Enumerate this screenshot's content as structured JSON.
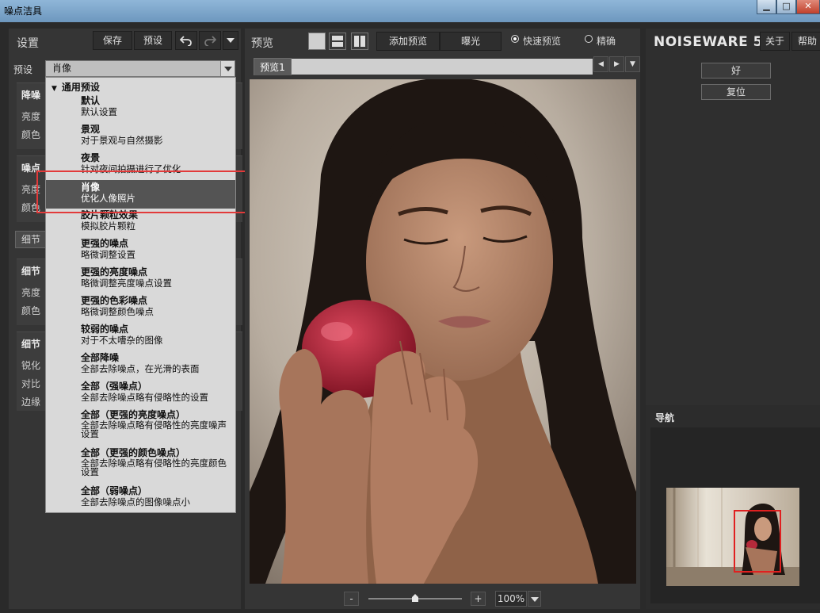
{
  "window": {
    "title": "噪点洁具",
    "min_glyph": "▁",
    "max_glyph": "□",
    "close_glyph": "✕"
  },
  "left": {
    "header": "设置",
    "save_label": "保存",
    "preset_label": "预设",
    "undo_icon": "undo-icon",
    "redo_icon": "redo-icon",
    "menu_icon": "chevron-down-icon",
    "preset_field_label": "预设",
    "preset_value": "肖像",
    "groups": [
      {
        "title": "降噪",
        "rows": [
          "亮度",
          "颜色"
        ]
      },
      {
        "title": "噪点",
        "rows": [
          "亮度",
          "颜色"
        ]
      },
      {
        "tab": "细节"
      },
      {
        "title": "细节",
        "rows": [
          "亮度",
          "颜色"
        ]
      },
      {
        "title": "细节",
        "rows": [
          "锐化",
          "对比",
          "边缘"
        ]
      }
    ]
  },
  "dropdown": {
    "group_header": "通用预设",
    "items": [
      {
        "name": "默认",
        "desc": "默认设置"
      },
      {
        "name": "景观",
        "desc": "对于景观与自然摄影"
      },
      {
        "name": "夜景",
        "desc": "针对夜间拍摄进行了优化"
      },
      {
        "name": "肖像",
        "desc": "优化人像照片",
        "selected": true
      },
      {
        "name": "胶片颗粒效果",
        "desc": "模拟胶片颗粒"
      },
      {
        "name": "更强的噪点",
        "desc": "略微调整设置"
      },
      {
        "name": "更强的亮度噪点",
        "desc": "略微调整亮度噪点设置"
      },
      {
        "name": "更强的色彩噪点",
        "desc": "略微调整颜色噪点"
      },
      {
        "name": "较弱的噪点",
        "desc": "对于不太嘈杂的图像"
      },
      {
        "name": "全部降噪",
        "desc": "全部去除噪点，在光滑的表面"
      },
      {
        "name": "全部（强噪点）",
        "desc": "全部去除噪点略有侵略性的设置"
      },
      {
        "name": "全部（更强的亮度噪点）",
        "desc": "全部去除噪点略有侵略性的亮度噪声设置"
      },
      {
        "name": "全部（更强的颜色噪点）",
        "desc": "全部去除噪点略有侵略性的亮度颜色设置"
      },
      {
        "name": "全部（弱噪点）",
        "desc": "全部去除噪点的图像噪点小"
      }
    ]
  },
  "center": {
    "header": "预览",
    "add_preview": "添加预览",
    "exposure": "曝光",
    "fast_preview": "快速预览",
    "accurate": "精确",
    "fast_selected": true,
    "tab": "预览1",
    "zoom": "100%",
    "zoom_minus": "-",
    "zoom_plus": "+",
    "zoom_level_fraction": 0.5
  },
  "right": {
    "brand": "NOISEWARE",
    "version": "5",
    "about": "关于",
    "help": "帮助",
    "ok": "好",
    "reset": "复位",
    "nav_title": "导航"
  },
  "colors": {
    "accent_red": "#e23a3a",
    "panel": "#353535",
    "dropdown_bg": "#d9d9d9",
    "selected": "#545454"
  }
}
